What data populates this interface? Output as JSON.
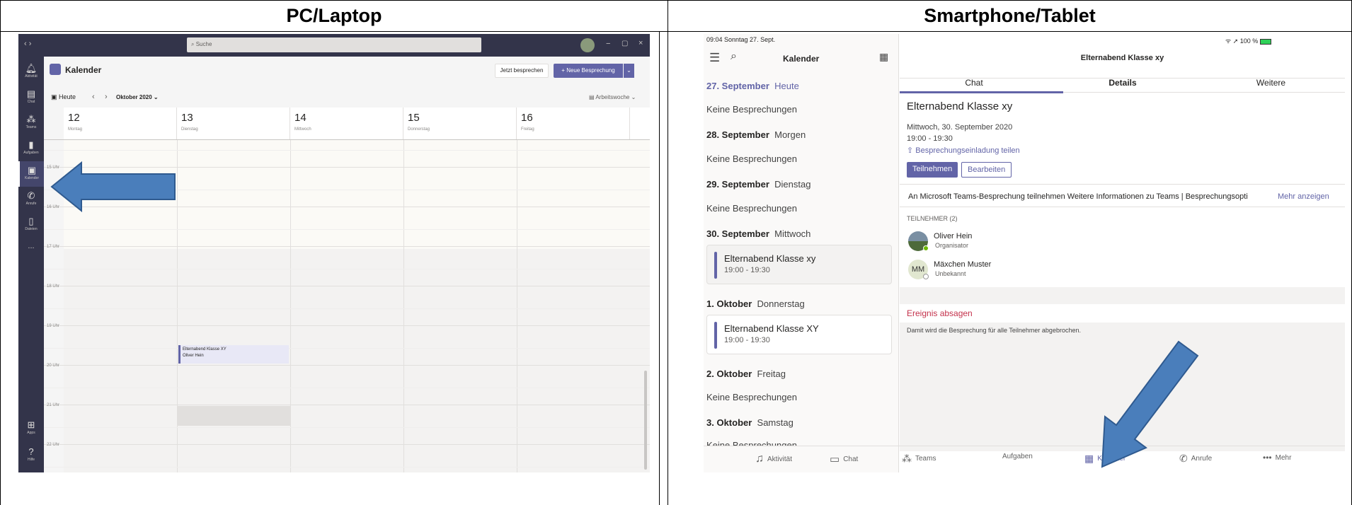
{
  "headers": {
    "left": "PC/Laptop",
    "right": "Smartphone/Tablet"
  },
  "pc": {
    "search_placeholder": "Suche",
    "window_controls": [
      "−",
      "▢",
      "×"
    ],
    "rail": [
      {
        "label": "Aktivität",
        "icon": "bell-icon"
      },
      {
        "label": "Chat",
        "icon": "chat-icon"
      },
      {
        "label": "Teams",
        "icon": "teams-icon"
      },
      {
        "label": "Aufgaben",
        "icon": "tasks-icon"
      },
      {
        "label": "Kalender",
        "icon": "calendar-icon"
      },
      {
        "label": "Anrufe",
        "icon": "phone-icon"
      },
      {
        "label": "Dateien",
        "icon": "files-icon"
      },
      {
        "label": "...",
        "icon": "more-icon"
      }
    ],
    "rail_bottom": [
      {
        "label": "Apps",
        "icon": "apps-icon"
      },
      {
        "label": "Hilfe",
        "icon": "help-icon"
      }
    ],
    "title": "Kalender",
    "meet_now": "Jetzt besprechen",
    "new_meeting": "+ Neue Besprechung",
    "today": "Heute",
    "month": "Oktober 2020",
    "view": "Arbeitswoche",
    "days": [
      {
        "num": "12",
        "name": "Montag"
      },
      {
        "num": "13",
        "name": "Dienstag"
      },
      {
        "num": "14",
        "name": "Mittwoch"
      },
      {
        "num": "15",
        "name": "Donnerstag"
      },
      {
        "num": "16",
        "name": "Freitag"
      }
    ],
    "hours": [
      "15 Uhr",
      "16 Uhr",
      "17 Uhr",
      "18 Uhr",
      "19 Uhr",
      "20 Uhr",
      "21 Uhr",
      "22 Uhr"
    ],
    "event": {
      "title": "Elternabend Klasse XY",
      "organizer": "Oliver Hein"
    }
  },
  "tablet": {
    "status_time": "09:04  Sonntag 27. Sept.",
    "status_right": "100 %",
    "nav_title": "Kalender",
    "days": [
      {
        "date": "27. September",
        "label": "Heute",
        "empty": "Keine Besprechungen"
      },
      {
        "date": "28. September",
        "label": "Morgen",
        "empty": "Keine Besprechungen"
      },
      {
        "date": "29. September",
        "label": "Dienstag",
        "empty": "Keine Besprechungen"
      },
      {
        "date": "30. September",
        "label": "Mittwoch"
      },
      {
        "date": "1. Oktober",
        "label": "Donnerstag"
      },
      {
        "date": "2. Oktober",
        "label": "Freitag",
        "empty": "Keine Besprechungen"
      },
      {
        "date": "3. Oktober",
        "label": "Samstag",
        "empty": "Keine Besprechungen"
      }
    ],
    "cards": [
      {
        "title": "Elternabend Klasse xy",
        "time": "19:00 - 19:30"
      },
      {
        "title": "Elternabend Klasse XY",
        "time": "19:00 - 19:30"
      }
    ],
    "detail": {
      "header": "Elternabend Klasse xy",
      "tabs": [
        "Chat",
        "Details",
        "Weitere"
      ],
      "title": "Elternabend Klasse xy",
      "date": "Mittwoch, 30. September 2020",
      "time": "19:00 - 19:30",
      "share": "Besprechungseinladung teilen",
      "join": "Teilnehmen",
      "edit": "Bearbeiten",
      "desc": "An Microsoft Teams-Besprechung teilnehmen Weitere Informationen zu Teams | Besprechungsopti",
      "more": "Mehr anzeigen",
      "participants_label": "TEILNEHMER (2)",
      "participants": [
        {
          "name": "Oliver Hein",
          "role": "Organisator",
          "initials": ""
        },
        {
          "name": "Mäxchen Muster",
          "role": "Unbekannt",
          "initials": "MM"
        }
      ],
      "cancel": "Ereignis absagen",
      "cancel_note": "Damit wird die Besprechung für alle Teilnehmer abgebrochen."
    },
    "tabbar": [
      {
        "label": "Aktivität",
        "icon": "bell-icon"
      },
      {
        "label": "Chat",
        "icon": "chat-icon"
      },
      {
        "label": "Teams",
        "icon": "teams-icon"
      },
      {
        "label": "Aufgaben",
        "icon": ""
      },
      {
        "label": "Kalender",
        "icon": "calendar-icon"
      },
      {
        "label": "Anrufe",
        "icon": "phone-icon"
      },
      {
        "label": "Mehr",
        "icon": "more-icon"
      }
    ]
  },
  "colors": {
    "accent": "#6264a7",
    "rail": "#33344a",
    "arrow": "#4a7ebb",
    "cancel": "#c4314b"
  }
}
